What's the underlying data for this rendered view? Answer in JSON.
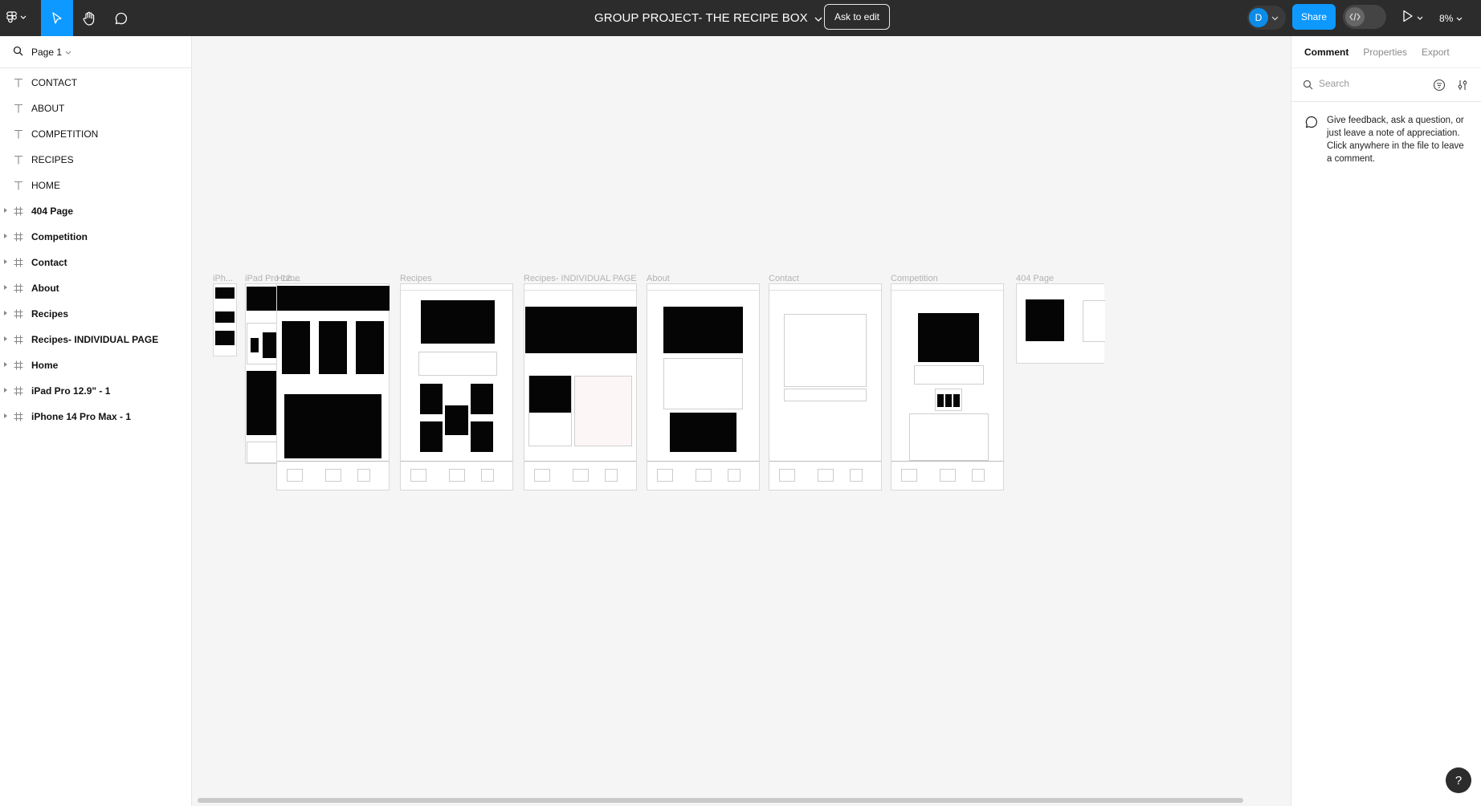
{
  "toolbar": {
    "file_title": "GROUP PROJECT- THE RECIPE BOX",
    "ask_to_edit": "Ask to edit",
    "avatar_initial": "D",
    "share": "Share",
    "zoom": "8%",
    "tools": [
      "figma-menu-icon",
      "move-tool-icon",
      "hand-tool-icon",
      "comment-tool-icon"
    ],
    "accent": "#0d99ff"
  },
  "layers_panel": {
    "page_name": "Page 1",
    "text_layers": [
      "CONTACT",
      "ABOUT",
      "COMPETITION",
      "RECIPES",
      "HOME"
    ],
    "frame_layers": [
      "404 Page",
      "Competition",
      "Contact",
      "About",
      "Recipes",
      "Recipes- INDIVIDUAL PAGE",
      "Home",
      "iPad Pro 12.9\" - 1",
      "iPhone 14 Pro Max - 1"
    ]
  },
  "canvas": {
    "frame_labels": {
      "iphone": "iPh...",
      "ipad": "iPad Pro 12....",
      "home": "Home",
      "recipes": "Recipes",
      "recipes_individual": "Recipes- INDIVIDUAL PAGE",
      "about": "About",
      "contact": "Contact",
      "competition": "Competition",
      "page404": "404 Page"
    }
  },
  "right_panel": {
    "tabs": [
      "Comment",
      "Properties",
      "Export"
    ],
    "active_tab": "Comment",
    "search_placeholder": "Search",
    "hint": "Give feedback, ask a question, or just leave a note of appreciation. Click anywhere in the file to leave a comment."
  },
  "help": "?"
}
